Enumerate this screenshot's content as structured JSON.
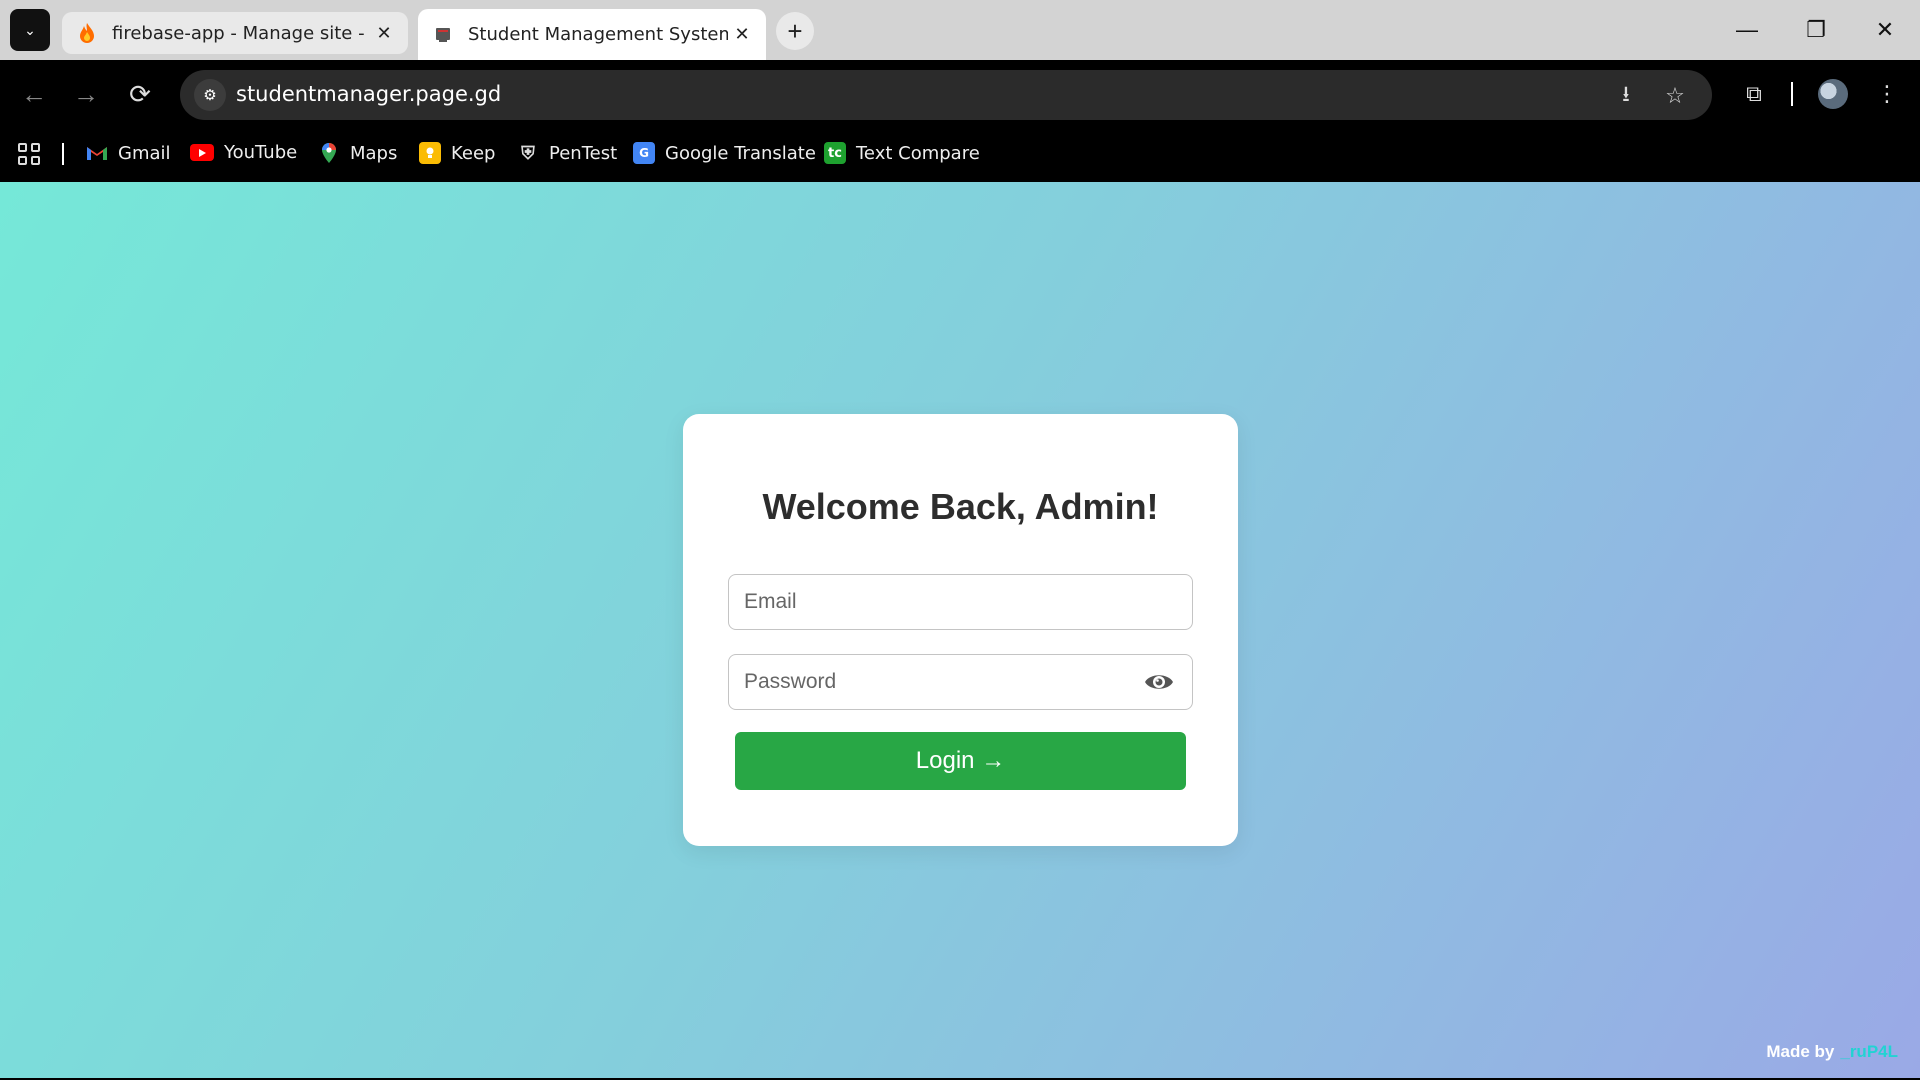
{
  "browser": {
    "tabs": [
      {
        "title": "firebase-app - Manage site - Da",
        "favicon": "firebase-flame-icon",
        "active": false
      },
      {
        "title": "Student Management System",
        "favicon": "page-icon",
        "active": true
      }
    ],
    "url": "studentmanager.page.gd",
    "bookmarks": [
      {
        "label": "Gmail",
        "icon": "gmail-icon"
      },
      {
        "label": "YouTube",
        "icon": "youtube-icon"
      },
      {
        "label": "Maps",
        "icon": "maps-icon"
      },
      {
        "label": "Keep",
        "icon": "keep-icon"
      },
      {
        "label": "PenTest",
        "icon": "pentest-icon"
      },
      {
        "label": "Google Translate",
        "icon": "translate-icon"
      },
      {
        "label": "Text Compare",
        "icon": "text-compare-icon"
      }
    ]
  },
  "login": {
    "heading": "Welcome Back, Admin!",
    "email_placeholder": "Email",
    "password_placeholder": "Password",
    "button_label": "Login →"
  },
  "footer": {
    "made_by": "Made by",
    "author": "_ruP4L"
  },
  "colors": {
    "login_button": "#28a745",
    "background_start": "#75e8d8",
    "background_end": "#9aa9e6"
  }
}
